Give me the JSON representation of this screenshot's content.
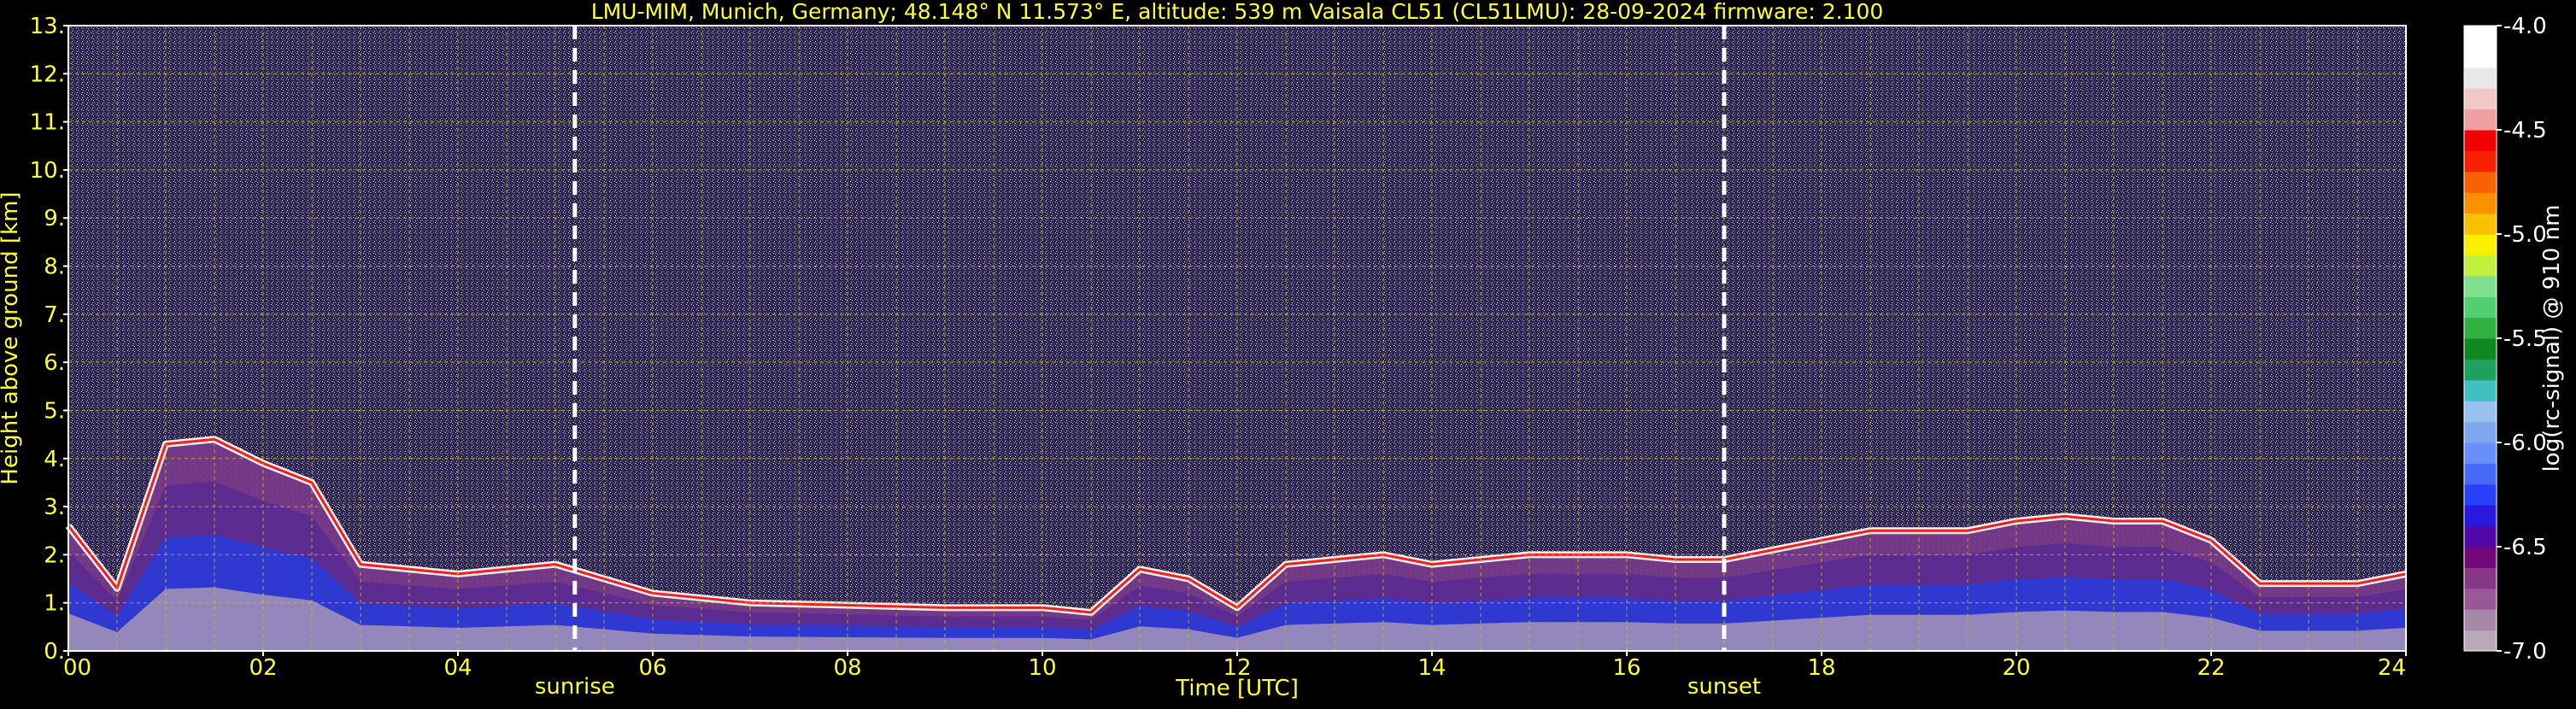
{
  "chart_data": {
    "type": "heatmap",
    "title": "LMU-MIM, Munich, Germany; 48.148° N 11.573° E, altitude: 539 m    Vaisala CL51 (CL51LMU): 28-09-2024    firmware: 2.100",
    "xlabel": "Time [UTC]",
    "ylabel": "Height above ground [km]",
    "xlim": [
      0,
      24
    ],
    "ylim": [
      0,
      13
    ],
    "x_ticks": [
      "00",
      "02",
      "04",
      "06",
      "08",
      "10",
      "12",
      "14",
      "16",
      "18",
      "20",
      "22",
      "24"
    ],
    "y_ticks": [
      "0.",
      "1.",
      "2.",
      "3.",
      "4.",
      "5.",
      "6.",
      "7.",
      "8.",
      "9.",
      "10.",
      "11.",
      "12.",
      "13."
    ],
    "grid": true,
    "sunrise": {
      "time": 5.2,
      "label": "sunrise"
    },
    "sunset": {
      "time": 17.0,
      "label": "sunset"
    },
    "colorbar": {
      "label": "log(rc-signal) @ 910 nm",
      "range": [
        -7.0,
        -4.0
      ],
      "ticks": [
        "-4.0",
        "-4.5",
        "-5.0",
        "-5.5",
        "-6.0",
        "-6.5",
        "-7.0"
      ],
      "colors": [
        "#b8a8b8",
        "#a888a8",
        "#985898",
        "#883888",
        "#700878",
        "#5008a8",
        "#2818e0",
        "#2840f8",
        "#4868f8",
        "#6890f8",
        "#80a8f0",
        "#98c0f0",
        "#40c0c0",
        "#20a060",
        "#108820",
        "#30b040",
        "#50d070",
        "#80e090",
        "#c0f040",
        "#f8f000",
        "#f8c000",
        "#f89000",
        "#f86000",
        "#f82000",
        "#f00000",
        "#f0a0a0",
        "#f0c8c8",
        "#e8e8e8",
        "#ffffff",
        "#ffffff"
      ]
    },
    "cloud_layer": {
      "x": [
        0.0,
        0.5,
        1.0,
        1.5,
        2.0,
        2.5,
        3.0,
        3.5,
        4.0,
        4.5,
        5.0,
        5.5,
        6.0,
        7.0,
        8.0,
        9.0,
        10.0,
        10.5,
        11.0,
        11.5,
        12.0,
        12.5,
        13.0,
        13.5,
        14.0,
        14.5,
        15.0,
        15.5,
        16.0,
        16.5,
        17.0,
        17.5,
        18.0,
        18.5,
        19.0,
        19.5,
        20.0,
        20.5,
        21.0,
        21.5,
        22.0,
        22.5,
        23.0,
        23.5,
        24.0
      ],
      "y": [
        2.6,
        1.3,
        4.3,
        4.4,
        3.9,
        3.5,
        1.8,
        1.7,
        1.6,
        1.7,
        1.8,
        1.5,
        1.2,
        1.0,
        0.95,
        0.9,
        0.9,
        0.8,
        1.7,
        1.5,
        0.9,
        1.8,
        1.9,
        2.0,
        1.8,
        1.9,
        2.0,
        2.0,
        2.0,
        1.9,
        1.9,
        2.1,
        2.3,
        2.5,
        2.5,
        2.5,
        2.7,
        2.8,
        2.7,
        2.7,
        2.3,
        1.4,
        1.4,
        1.4,
        1.6
      ]
    }
  }
}
